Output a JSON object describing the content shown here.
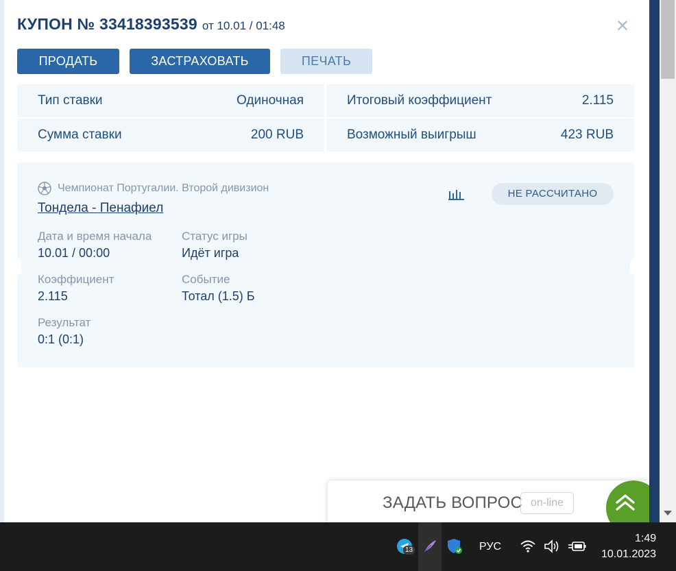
{
  "coupon": {
    "title": "КУПОН № 33418393539",
    "date": "от 10.01 / 01:48",
    "close_symbol": "×"
  },
  "actions": {
    "sell": "ПРОДАТЬ",
    "insure": "ЗАСТРАХОВАТЬ",
    "print": "ПЕЧАТЬ"
  },
  "summary": {
    "bet_type_label": "Тип ставки",
    "bet_type_value": "Одиночная",
    "total_odds_label": "Итоговый коэффициент",
    "total_odds_value": "2.115",
    "stake_label": "Сумма ставки",
    "stake_value": "200 RUB",
    "win_label": "Возможный выигрыш",
    "win_value": "423 RUB"
  },
  "event": {
    "league": "Чемпионат Португалии. Второй дивизион",
    "match": "Тондела - Пенафиел",
    "status_badge": "НЕ РАССЧИТАНО",
    "start_label": "Дата и время начала",
    "start_value": "10.01 / 00:00",
    "game_status_label": "Статус игры",
    "game_status_value": "Идёт игра",
    "odds_label": "Коэффициент",
    "odds_value": "2.115",
    "bet_event_label": "Событие",
    "bet_event_value": "Тотал (1.5) Б",
    "result_label": "Результат",
    "result_value": "0:1 (0:1)"
  },
  "chat": {
    "ask_label": "ЗАДАТЬ ВОПРОС",
    "online_label": "on-line"
  },
  "taskbar": {
    "telegram_badge": "13",
    "language": "РУС",
    "time": "1:49",
    "date": "10.01.2023"
  },
  "colors": {
    "primary": "#2a67a9",
    "title": "#1c3f6e",
    "green": "#5a9f28"
  }
}
